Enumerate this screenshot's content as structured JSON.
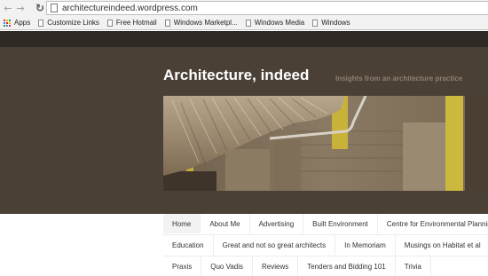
{
  "browser": {
    "url": "architectureindeed.wordpress.com",
    "bookmarks": [
      {
        "label": "Apps",
        "icon": "apps-grid-icon"
      },
      {
        "label": "Customize Links",
        "icon": "page-icon"
      },
      {
        "label": "Free Hotmail",
        "icon": "page-icon"
      },
      {
        "label": "Windows Marketpl...",
        "icon": "page-icon"
      },
      {
        "label": "Windows Media",
        "icon": "page-icon"
      },
      {
        "label": "Windows",
        "icon": "page-icon"
      }
    ]
  },
  "site": {
    "title": "Architecture, indeed",
    "tagline": "Insights from an architecture practice"
  },
  "menu": {
    "row1": [
      "Home",
      "About Me",
      "Advertising",
      "Built Environment",
      "Centre for Environmental Planning"
    ],
    "row2": [
      "Education",
      "Great and not so great architects",
      "In Memoriam",
      "Musings on Habitat et al"
    ],
    "row3": [
      "Praxis",
      "Quo Vadis",
      "Reviews",
      "Tenders and Bidding 101",
      "Trivia"
    ]
  },
  "colors": {
    "header_bg": "#4a4036",
    "topbar_bg": "#2e2924",
    "tagline": "#8f8070"
  }
}
